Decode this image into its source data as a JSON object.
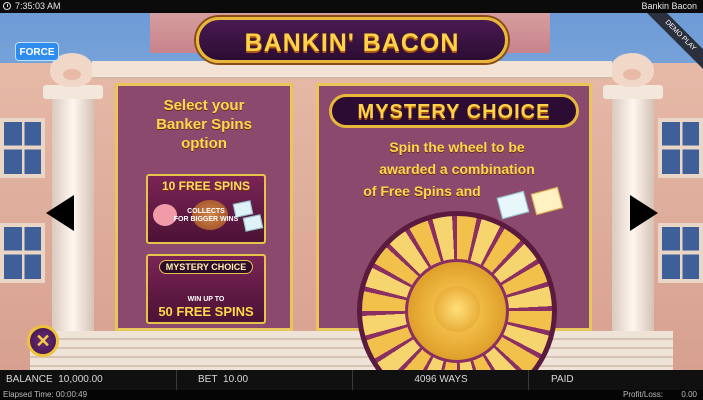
{
  "system_bar": {
    "time": "7:35:03 AM",
    "game_name": "Bankin Bacon",
    "clock_icon": "clock-icon"
  },
  "header": {
    "title": "BANKIN' BACON",
    "force_label": "FORCE",
    "demo_label": "DEMO PLAY"
  },
  "left_panel": {
    "heading_lines": [
      "Select your",
      "Banker Spins",
      "option"
    ],
    "card_free_spins": {
      "title": "10 FREE SPINS",
      "sub_line1": "COLLECTS",
      "sub_line2": "FOR BIGGER WINS"
    },
    "card_mystery": {
      "title": "MYSTERY CHOICE",
      "sub": "WIN UP TO",
      "big": "50 FREE SPINS"
    }
  },
  "right_panel": {
    "title": "MYSTERY CHOICE",
    "text_lines": [
      "Spin the wheel to be",
      "awarded a combination",
      "of Free Spins and"
    ]
  },
  "nav": {
    "prev_icon": "arrow-left-icon",
    "next_icon": "arrow-right-icon",
    "close_icon": "close-icon",
    "close_glyph": "✕"
  },
  "status_bar": {
    "balance_label": "BALANCE",
    "balance_value": "10,000.00",
    "bet_label": "BET",
    "bet_value": "10.00",
    "ways": "4096 WAYS",
    "paid_label": "PAID"
  },
  "footer": {
    "elapsed": "Elapsed Time: 00:00:49",
    "profit_label": "Profit/Loss:",
    "profit_value": "0.00"
  },
  "colors": {
    "accent_gold": "#ffd24a",
    "panel_purple": "#8b4a6d",
    "force_blue": "#2f8df0"
  }
}
